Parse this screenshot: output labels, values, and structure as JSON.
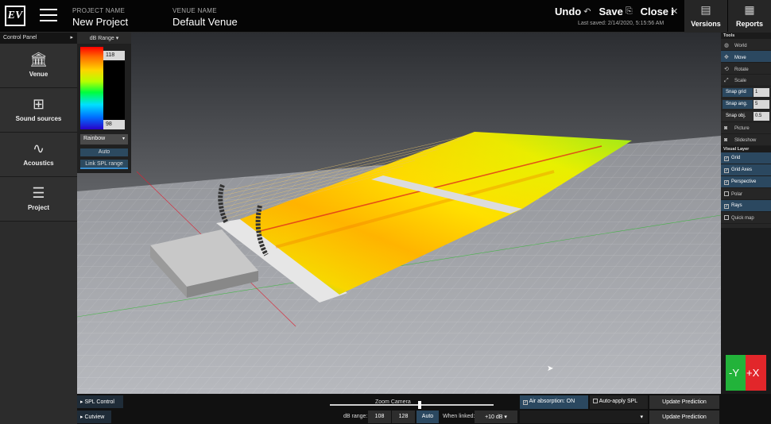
{
  "topbar": {
    "logo": "EV",
    "project_label": "PROJECT NAME",
    "project_name": "New Project",
    "venue_label": "VENUE NAME",
    "venue_name": "Default Venue",
    "undo": "Undo",
    "save": "Save",
    "close": "Close",
    "last_saved": "Last saved: 2/14/2020, 5:15:56 AM",
    "info": "i",
    "versions": "Versions",
    "reports": "Reports"
  },
  "sidebar": {
    "header": "Control Panel",
    "items": [
      {
        "label": "Venue",
        "icon": "venue-icon"
      },
      {
        "label": "Sound sources",
        "icon": "sound-sources-icon"
      },
      {
        "label": "Acoustics",
        "icon": "acoustics-icon"
      },
      {
        "label": "Project",
        "icon": "project-icon"
      }
    ]
  },
  "db_panel": {
    "header": "dB Range",
    "max": "118",
    "min": "98",
    "palette": "Rainbow",
    "auto": "Auto",
    "link": "Link SPL range"
  },
  "tools": {
    "section_tools": "Tools",
    "world": "World",
    "move": "Move",
    "rotate": "Rotate",
    "scale": "Scale",
    "snap_grid_label": "Snap grid",
    "snap_grid_value": "1",
    "snap_ang_label": "Snap ang.",
    "snap_ang_value": "5",
    "snap_obj_label": "Snap obj.",
    "snap_obj_value": "0.5",
    "picture": "Picture",
    "slideshow": "Slideshow",
    "section_visual": "Visual Layer",
    "grid": "Grid",
    "grid_axes": "Grid Axes",
    "perspective": "Perspective",
    "polar": "Polar",
    "rays": "Rays",
    "quick_map": "Quick map",
    "checked": {
      "grid": true,
      "grid_axes": true,
      "perspective": true,
      "polar": false,
      "rays": true,
      "quick_map": false
    }
  },
  "bottom": {
    "spl_control": "SPL Control",
    "cutview": "Cutview",
    "zoom_camera": "Zoom Camera",
    "zoom_level": 0.55,
    "air_absorption": "Air absorption: ON",
    "auto_apply": "Auto-apply SPL",
    "update_1": "Update Prediction",
    "update_2": "Update Prediction",
    "db_range_label": "dB range:",
    "db_low": "108",
    "db_high": "128",
    "auto": "Auto",
    "when_linked": "When linked:",
    "linked_value": "+10 dB"
  },
  "gizmo": {
    "y_label": "-Y",
    "x_label": "+X"
  }
}
